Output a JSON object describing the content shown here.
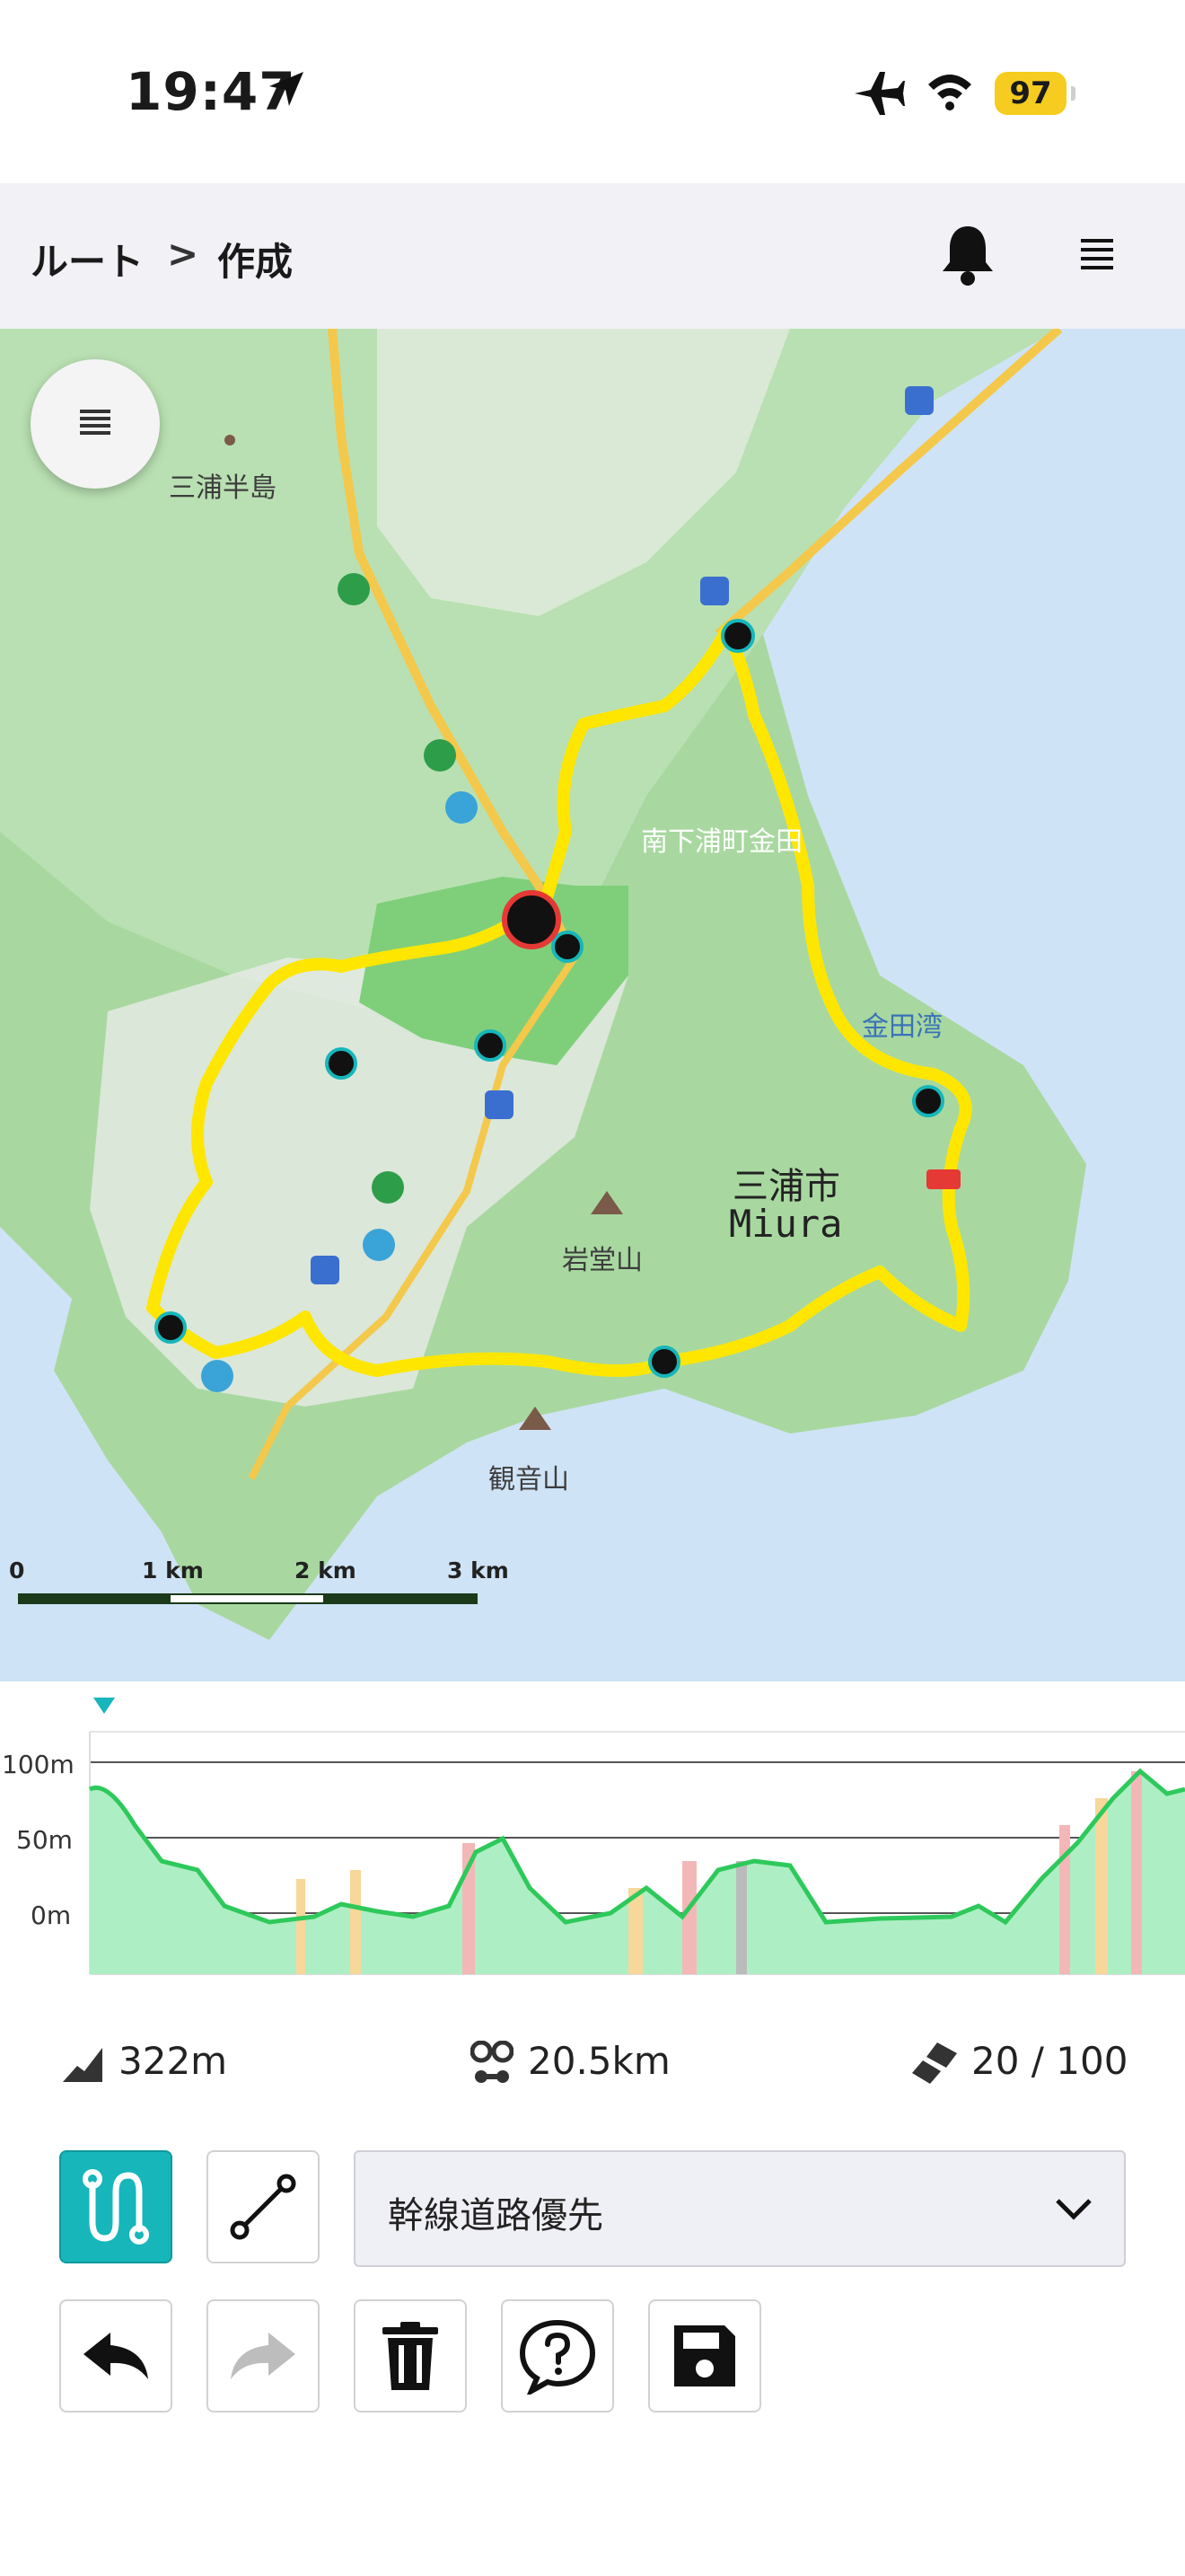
{
  "status_bar": {
    "time": "19:47",
    "battery": "97"
  },
  "header": {
    "crumb_parent": "ルート",
    "crumb_separator": ">",
    "crumb_current": "作成"
  },
  "map": {
    "labels": {
      "peninsula": "三浦半島",
      "district": "南下浦町金田",
      "bay": "金田湾",
      "city_ja": "三浦市",
      "city_en": "Miura",
      "mountain1": "岩堂山",
      "mountain2": "観音山"
    },
    "scale": {
      "l0": "0",
      "l1": "1 km",
      "l2": "2 km",
      "l3": "3 km"
    }
  },
  "elevation": {
    "y_labels": {
      "high": "100m",
      "mid": "50m",
      "low": "0m"
    }
  },
  "stats": {
    "climb": "322m",
    "distance": "20.5km",
    "points": "20 / 100"
  },
  "routing": {
    "selected": "幹線道路優先"
  },
  "colors": {
    "accent": "#16b6ba",
    "route": "#ffe600",
    "elevation_line": "#2ec95b"
  }
}
